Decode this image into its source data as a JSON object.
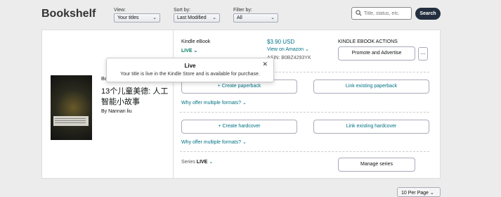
{
  "header": {
    "title": "Bookshelf",
    "view": {
      "label": "View:",
      "value": "Your titles"
    },
    "sort": {
      "label": "Sort by:",
      "value": "Last Modified"
    },
    "filter": {
      "label": "Filter by:",
      "value": "All"
    },
    "search_placeholder": "Title, status, etc.",
    "search_button": "Search"
  },
  "book": {
    "author_truncated": "Bo",
    "title": "13个儿童美德: 人工智能小故事",
    "by_line": "By Nannan liu"
  },
  "ebook": {
    "format": "Kindle eBook",
    "status": "LIVE",
    "price": "$3.90 USD",
    "view_on_amazon": "View on Amazon",
    "asin": "ASIN: B0BZ4293YK",
    "actions_header": "KINDLE EBOOK ACTIONS",
    "promote_button": "Promote and Advertise",
    "more_button": "..."
  },
  "paperback": {
    "create": "+ Create paperback",
    "link": "Link existing paperback",
    "why": "Why offer multiple formats?"
  },
  "hardcover": {
    "create": "+ Create hardcover",
    "link": "Link existing hardcover",
    "why": "Why offer multiple formats?"
  },
  "series": {
    "label": "Series",
    "status": "LIVE",
    "manage_button": "Manage series"
  },
  "tooltip": {
    "title": "Live",
    "body": "Your title is live in the Kindle Store and is available for purchase."
  },
  "pagination": {
    "per_page": "10 Per Page"
  },
  "colors": {
    "live_green": "#067d62",
    "link_teal": "#007185",
    "search_button_bg": "#232f3e"
  }
}
